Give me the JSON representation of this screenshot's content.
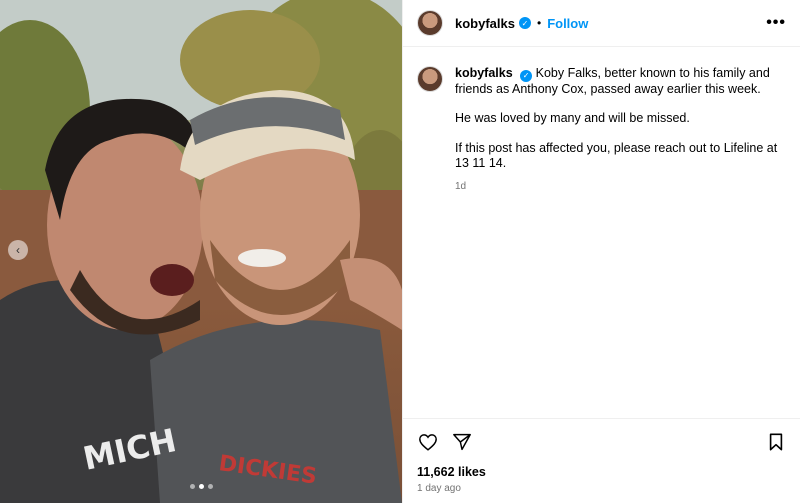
{
  "post": {
    "username": "kobyfalks",
    "follow_label": "Follow",
    "separator": "•",
    "more_label": "•••",
    "caption_lines": [
      "Koby Falks, better known to his family and friends as Anthony Cox, passed away earlier this week.",
      "He was loved by many and will be missed.",
      "If this post has affected you, please reach out to Lifeline at 13 11 14."
    ],
    "caption_time": "1d",
    "likes": "11,662 likes",
    "posted_ago": "1 day ago",
    "verified_badge": "✓"
  },
  "media": {
    "carousel_prev": "‹",
    "carousel_count": 3,
    "carousel_active_index": 1,
    "shirt_text_left": "MICH",
    "shirt_text_right": "DICKIES"
  },
  "icons": {
    "heart": "heart-icon",
    "share": "share-icon",
    "bookmark": "bookmark-icon",
    "verified": "verified-badge-icon"
  },
  "colors": {
    "accent": "#0095f6",
    "muted": "#737373",
    "divider": "#efefef"
  }
}
